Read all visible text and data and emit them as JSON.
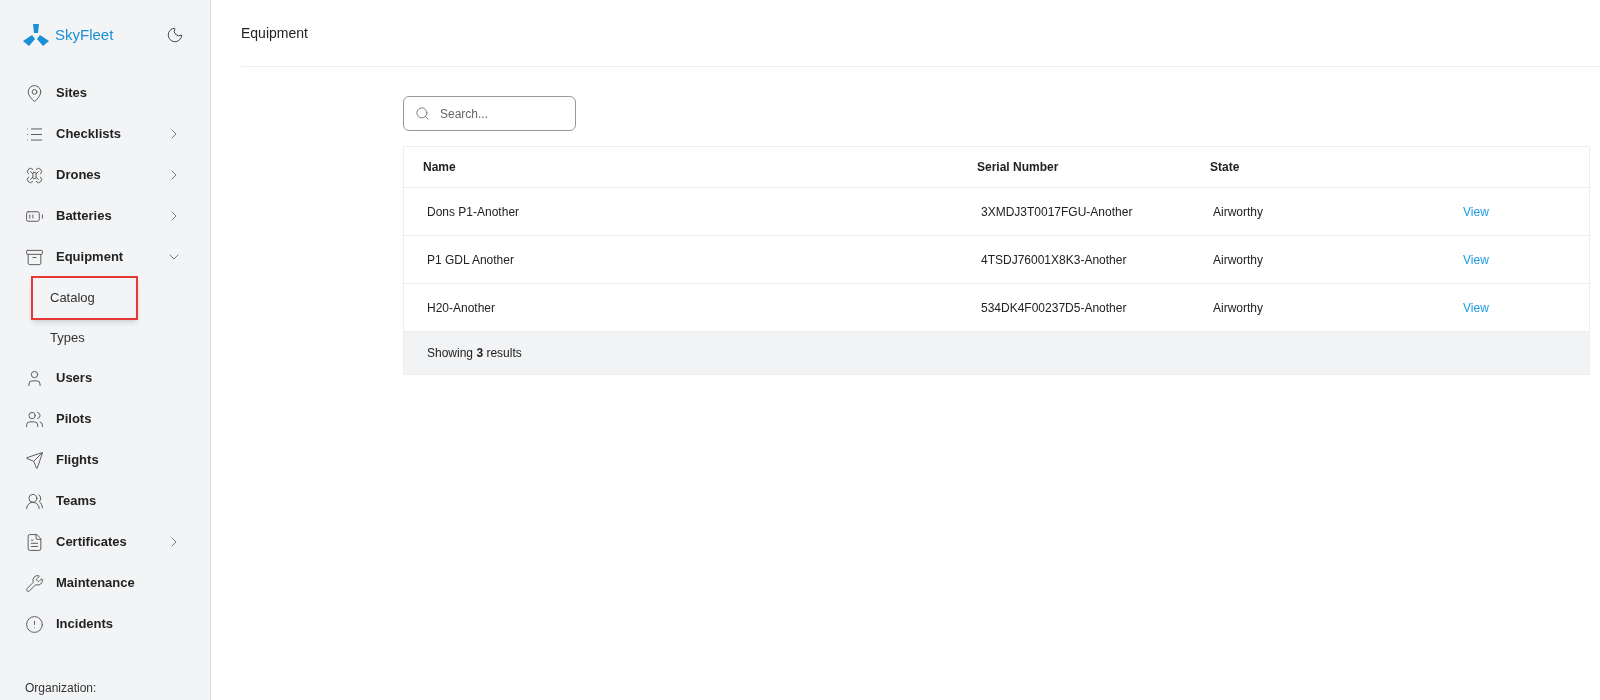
{
  "brand": {
    "name": "SkyFleet"
  },
  "sidebar": {
    "items": [
      {
        "label": "Sites"
      },
      {
        "label": "Checklists",
        "expanded": false
      },
      {
        "label": "Drones",
        "expanded": false
      },
      {
        "label": "Batteries",
        "expanded": false
      },
      {
        "label": "Equipment",
        "expanded": true,
        "children": [
          {
            "label": "Catalog",
            "highlighted": true
          },
          {
            "label": "Types",
            "highlighted": false
          }
        ]
      },
      {
        "label": "Users"
      },
      {
        "label": "Pilots"
      },
      {
        "label": "Flights"
      },
      {
        "label": "Teams"
      },
      {
        "label": "Certificates",
        "expanded": false
      },
      {
        "label": "Maintenance"
      },
      {
        "label": "Incidents"
      }
    ],
    "organization_label": "Organization:"
  },
  "page": {
    "title": "Equipment"
  },
  "search": {
    "placeholder": "Search..."
  },
  "table": {
    "columns": [
      "Name",
      "Serial Number",
      "State"
    ],
    "rows": [
      {
        "name": "Dons P1-Another",
        "serial": "3XMDJ3T0017FGU-Another",
        "state": "Airworthy",
        "action": "View"
      },
      {
        "name": "P1 GDL Another",
        "serial": "4TSDJ76001X8K3-Another",
        "state": "Airworthy",
        "action": "View"
      },
      {
        "name": "H20-Another",
        "serial": "534DK4F00237D5-Another",
        "state": "Airworthy",
        "action": "View"
      }
    ],
    "footer": "Showing **3** results"
  }
}
